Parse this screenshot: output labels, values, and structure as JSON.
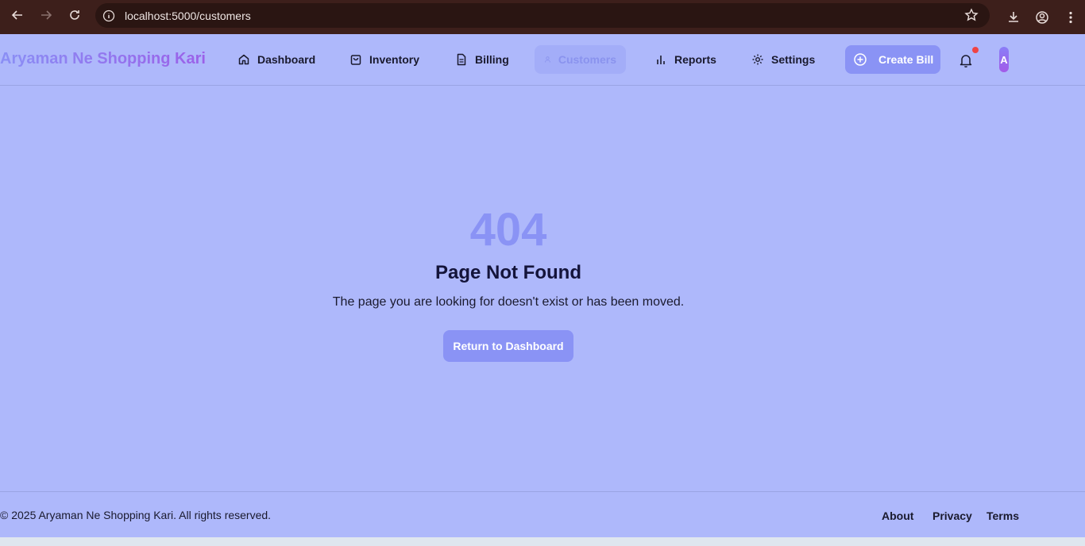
{
  "browser": {
    "url": "localhost:5000/customers"
  },
  "header": {
    "brand": "Aryaman Ne Shopping Kari",
    "nav": [
      {
        "label": "Dashboard",
        "icon": "home-icon"
      },
      {
        "label": "Inventory",
        "icon": "bag-icon"
      },
      {
        "label": "Billing",
        "icon": "file-icon"
      },
      {
        "label": "Customers",
        "icon": "user-icon",
        "active": true
      },
      {
        "label": "Reports",
        "icon": "bar-chart-icon"
      },
      {
        "label": "Settings",
        "icon": "gear-icon"
      }
    ],
    "create_bill": "Create Bill",
    "avatar_initial": "A"
  },
  "main": {
    "code": "404",
    "title": "Page Not Found",
    "description": "The page you are looking for doesn't exist or has been moved.",
    "return_button": "Return to Dashboard"
  },
  "footer": {
    "copyright": "© 2025 Aryaman Ne Shopping Kari. All rights reserved.",
    "links": [
      "About",
      "Privacy",
      "Terms"
    ]
  },
  "colors": {
    "background": "#aeb8fb",
    "accent": "#8a93f5",
    "notification": "#ef4444"
  }
}
